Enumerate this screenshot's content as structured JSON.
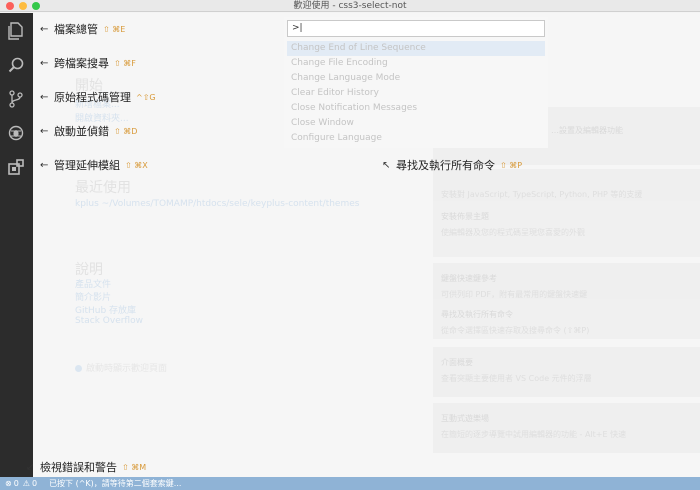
{
  "window": {
    "title": "歡迎使用 - css3-select-not"
  },
  "activity": [
    "files-icon",
    "search-icon",
    "source-control-icon",
    "debug-icon",
    "extensions-icon"
  ],
  "welcome": {
    "start_heading": "開始",
    "start_links": [
      "新增檔案...",
      "開啟資料夾..."
    ],
    "recent_heading": "最近使用",
    "recent_item": "kplus  ~/Volumes/TOMAMP/htdocs/sele/keyplus-content/themes",
    "help_heading": "說明",
    "help_links": [
      "產品文件",
      "簡介影片",
      "GitHub 存放庫",
      "Stack Overflow"
    ],
    "startup_check": "啟動時顯示歡迎頁面",
    "tiles": [
      {
        "title": "",
        "sub": "",
        "right": "…設置及編輯器功能"
      },
      {
        "title": "",
        "sub": "安裝對 JavaScript, TypeScript, Python, PHP 等的支援"
      },
      {
        "title": "安裝佈景主題",
        "sub": "使編輯器及您的程式碼呈現您喜愛的外觀"
      },
      {
        "title": "鍵盤快速鍵參考",
        "sub": "可供列印 PDF，附有最常用的鍵盤快速鍵"
      },
      {
        "title": "尋找及執行所有命令",
        "sub": "從命令選擇區快速存取及搜尋命令 (⇧⌘P)"
      },
      {
        "title": "介面概要",
        "sub": "查看突顯主要使用者 VS Code 元件的浮層"
      },
      {
        "title": "互動式遊樂場",
        "sub": "在簡短的逐步導覽中試用編輯器的功能 - Alt+E 快速"
      }
    ]
  },
  "palette": {
    "input_value": ">|",
    "items": [
      "Change End of Line Sequence",
      "Change File Encoding",
      "Change Language Mode",
      "Clear Editor History",
      "Close Notification Messages",
      "Close Window",
      "Configure Language"
    ]
  },
  "hints": {
    "explorer": {
      "label": "檔案總管",
      "keys": "⇧ ⌘E"
    },
    "search": {
      "label": "跨檔案搜尋",
      "keys": "⇧ ⌘F"
    },
    "scm": {
      "label": "原始程式碼管理",
      "keys": "^⇧G"
    },
    "debug": {
      "label": "啟動並偵錯",
      "keys": "⇧ ⌘D"
    },
    "extensions": {
      "label": "管理延伸模組",
      "keys": "⇧ ⌘X"
    },
    "commands": {
      "label": "尋找及執行所有命令",
      "keys": "⇧ ⌘P"
    },
    "problems": {
      "label": "檢視錯誤和警告",
      "keys": "⇧ ⌘M"
    }
  },
  "status": {
    "errors": "0",
    "warnings": "0",
    "message": "已按下 (^K)，請等待第二個套索鍵..."
  }
}
